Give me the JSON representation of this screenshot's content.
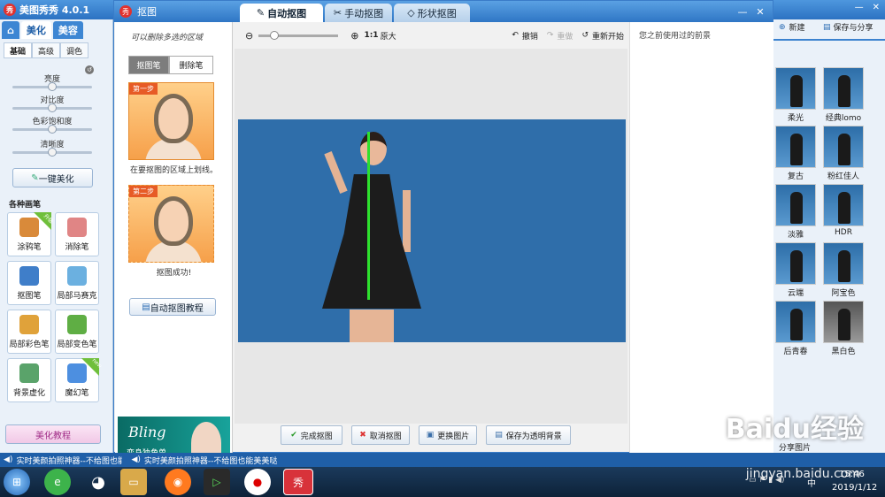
{
  "app": {
    "title": "美图秀秀 4.0.1",
    "logo_text": "秀"
  },
  "main_tabs": [
    {
      "label": "⌂",
      "icon": "home-icon"
    },
    {
      "label": "美化"
    },
    {
      "label": "美容"
    }
  ],
  "sub_tabs": [
    "基础",
    "高级",
    "调色"
  ],
  "adjustments": [
    {
      "label": "亮度",
      "value": 0.5
    },
    {
      "label": "对比度",
      "value": 0.5
    },
    {
      "label": "色彩饱和度",
      "value": 0.5
    },
    {
      "label": "清晰度",
      "value": 0.5
    }
  ],
  "one_click_label": "一键美化",
  "brush_section_label": "各种画笔",
  "brushes": [
    {
      "label": "涂鸦笔",
      "badge": "升级",
      "color": "#d98a3a"
    },
    {
      "label": "消除笔",
      "badge": "",
      "color": "#e08585"
    },
    {
      "label": "抠图笔",
      "badge": "",
      "color": "#3f7ec9"
    },
    {
      "label": "局部马赛克",
      "badge": "",
      "color": "#6bb0e0"
    },
    {
      "label": "局部彩色笔",
      "badge": "",
      "color": "#e0a23a"
    },
    {
      "label": "局部变色笔",
      "badge": "",
      "color": "#5fae44"
    },
    {
      "label": "背景虚化",
      "badge": "",
      "color": "#5aa36a"
    },
    {
      "label": "魔幻笔",
      "badge": "new",
      "color": "#4d8fe0"
    }
  ],
  "tutorial_label": "美化教程",
  "dialog": {
    "title": "抠图",
    "tabs": [
      "自动抠图",
      "手动抠图",
      "形状抠图"
    ],
    "window_buttons": [
      "—",
      "□",
      "✕"
    ],
    "hint": "可以删除多选的区域",
    "pen_tabs": [
      "抠图笔",
      "删除笔"
    ],
    "step1": {
      "badge": "第一步",
      "text": "在要抠图的区域上划线。"
    },
    "step2": {
      "badge": "第二步",
      "text": "抠图成功!"
    },
    "tutorial_button": "自动抠图教程",
    "banner": {
      "title": "Bling",
      "subtitle": "变身独角兽"
    },
    "toolbar": {
      "zoom_value": 0.2,
      "ratio_label": "1:1",
      "original_label": "原大",
      "undo": "撤销",
      "redo": "重做",
      "restart": "重新开始"
    },
    "right_pane_title": "您之前使用过的前景",
    "bottom_buttons": [
      "完成抠图",
      "取消抠图",
      "更换图片",
      "保存为透明背景"
    ]
  },
  "right_app": {
    "new_label": "新建",
    "save_label": "保存与分享",
    "effects": [
      [
        "柔光",
        "经典lomo"
      ],
      [
        "复古",
        "粉红佳人"
      ],
      [
        "淡雅",
        "HDR"
      ],
      [
        "云端",
        "阿宝色"
      ],
      [
        "后青春",
        "黑白色"
      ]
    ],
    "share_label": "分享图片"
  },
  "status": {
    "left": "实时美颜拍照神器--不给图也能美美哒",
    "right": "实时美颜拍照神器--不给图也能美美哒"
  },
  "taskbar": {
    "time": "15:46",
    "date": "2019/1/12",
    "lang": "中"
  },
  "watermark": {
    "brand": "Baidu经验",
    "url": "jingyan.baidu.com"
  }
}
